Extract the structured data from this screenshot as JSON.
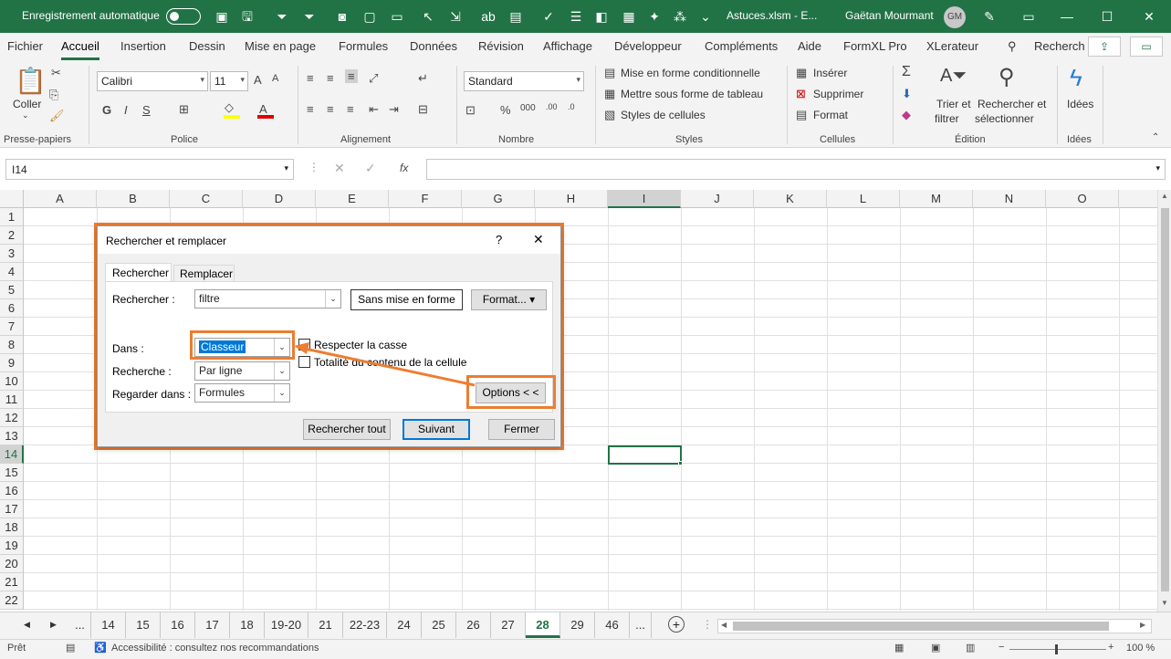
{
  "titlebar": {
    "autosave": "Enregistrement automatique",
    "filename": "Astuces.xlsm  -  E...",
    "user": "Gaëtan Mourmant",
    "initials": "GM",
    "minimize": "—",
    "maximize": "☐",
    "close": "✕"
  },
  "menu": [
    "Fichier",
    "Accueil",
    "Insertion",
    "Dessin",
    "Mise en page",
    "Formules",
    "Données",
    "Révision",
    "Affichage",
    "Développeur",
    "Compléments",
    "Aide",
    "FormXL Pro",
    "XLerateur"
  ],
  "search": "Recherch",
  "ribbon": {
    "coller": "Coller",
    "font_name": "Calibri",
    "font_size": "11",
    "number_format": "Standard",
    "cond_format": "Mise en forme conditionnelle",
    "table_format": "Mettre sous forme de tableau",
    "cell_styles": "Styles de cellules",
    "inserer": "Insérer",
    "supprimer": "Supprimer",
    "format": "Format",
    "trier1": "Trier et",
    "trier2": "filtrer",
    "rech1": "Rechercher et",
    "rech2": "sélectionner",
    "idees": "Idées",
    "groups": [
      "Presse-papiers",
      "Police",
      "Alignement",
      "Nombre",
      "Styles",
      "Cellules",
      "Édition",
      "Idées"
    ]
  },
  "formula": {
    "namebox": "I14",
    "fx": "fx"
  },
  "columns": [
    "A",
    "B",
    "C",
    "D",
    "E",
    "F",
    "G",
    "H",
    "I",
    "J",
    "K",
    "L",
    "M",
    "N",
    "O"
  ],
  "rows": [
    "1",
    "2",
    "3",
    "4",
    "5",
    "6",
    "7",
    "8",
    "9",
    "10",
    "11",
    "12",
    "13",
    "14",
    "15",
    "16",
    "17",
    "18",
    "19",
    "20",
    "21",
    "22"
  ],
  "dialog": {
    "title": "Rechercher et remplacer",
    "help": "?",
    "close": "✕",
    "tab_find": "Rechercher",
    "tab_replace": "Remplacer",
    "find_label": "Rechercher :",
    "find_value": "filtre",
    "no_format": "Sans mise en forme",
    "format_btn": "Format...",
    "dans_label": "Dans :",
    "dans_value": "Classeur",
    "recherche_label": "Recherche :",
    "recherche_value": "Par ligne",
    "regarder_label": "Regarder dans :",
    "regarder_value": "Formules",
    "case": "Respecter la casse",
    "whole": "Totalité du contenu de la cellule",
    "options": "Options < <",
    "find_all": "Rechercher tout",
    "next": "Suivant",
    "close_btn": "Fermer"
  },
  "sheets": [
    "...",
    "14",
    "15",
    "16",
    "17",
    "18",
    "19-20",
    "21",
    "22-23",
    "24",
    "25",
    "26",
    "27",
    "28",
    "29",
    "46",
    "..."
  ],
  "active_sheet": "28",
  "status": {
    "ready": "Prêt",
    "access": "Accessibilité : consultez nos recommandations",
    "zoom": "100 %"
  },
  "colors": {
    "excel_green": "#217346",
    "highlight": "#ed7d31"
  }
}
